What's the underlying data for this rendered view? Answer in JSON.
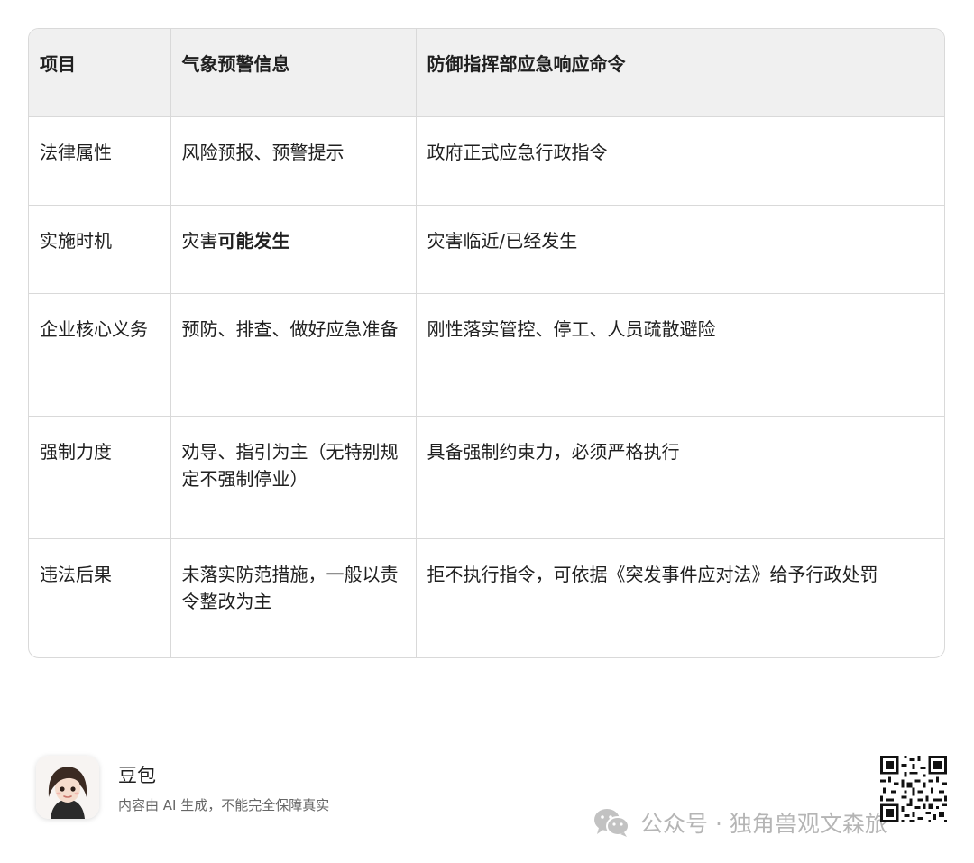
{
  "table": {
    "headers": [
      "项目",
      "气象预警信息",
      "防御指挥部应急响应命令"
    ],
    "rows": [
      {
        "item": "法律属性",
        "warning": "风险预报、预警提示",
        "command": "政府正式应急行政指令"
      },
      {
        "item": "实施时机",
        "warning_prefix": "灾害",
        "warning_bold": "可能发生",
        "command": "灾害临近/已经发生"
      },
      {
        "item": "企业核心义务",
        "warning": "预防、排查、做好应急准备",
        "command": "刚性落实管控、停工、人员疏散避险"
      },
      {
        "item": "强制力度",
        "warning": "劝导、指引为主（无特别规定不强制停业）",
        "command": "具备强制约束力，必须严格执行"
      },
      {
        "item": "违法后果",
        "warning": "未落实防范措施，一般以责令整改为主",
        "command": "拒不执行指令，可依据《突发事件应对法》给予行政处罚"
      }
    ]
  },
  "footer": {
    "brand_name": "豆包",
    "disclaimer": "内容由 AI 生成，不能完全保障真实",
    "watermark": "公众号 · 独角兽观文森旅",
    "avatar_icon": "avatar-girl-icon",
    "qr_icon": "qr-code-icon",
    "wechat_icon": "wechat-icon"
  }
}
